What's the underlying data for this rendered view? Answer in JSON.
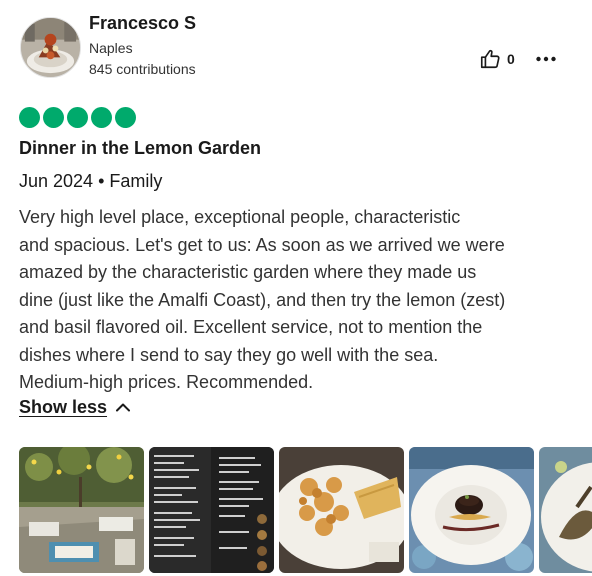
{
  "reviewer": {
    "name": "Francesco S",
    "location": "Naples",
    "contributions": "845 contributions",
    "avatar_icon": "profile-photo"
  },
  "actions": {
    "helpful_icon": "thumbs-up-icon",
    "helpful_count": "0",
    "more_icon": "more-options-icon"
  },
  "review": {
    "rating": 5,
    "rating_max": 5,
    "rating_color": "#00aa6c",
    "title": "Dinner in the Lemon Garden",
    "meta": "Jun 2024 • Family",
    "lines": [
      "Very high level place, exceptional people, characteristic",
      "and spacious. Let's get to us: As soon as we arrived we were",
      "amazed by the characteristic garden where they made us",
      "dine (just like the Amalfi Coast), and then try the lemon (zest)",
      "and basil flavored oil. Excellent service, not to mention the",
      "dishes where I send to say they go well with the sea.",
      "Medium-high prices. Recommended."
    ],
    "show_less_label": "Show less"
  },
  "photos": [
    {
      "subject": "lemon-garden-dining-area"
    },
    {
      "subject": "restaurant-menu"
    },
    {
      "subject": "fried-seafood-plate"
    },
    {
      "subject": "plated-dish-on-pasta"
    },
    {
      "subject": "seafood-plate"
    }
  ]
}
